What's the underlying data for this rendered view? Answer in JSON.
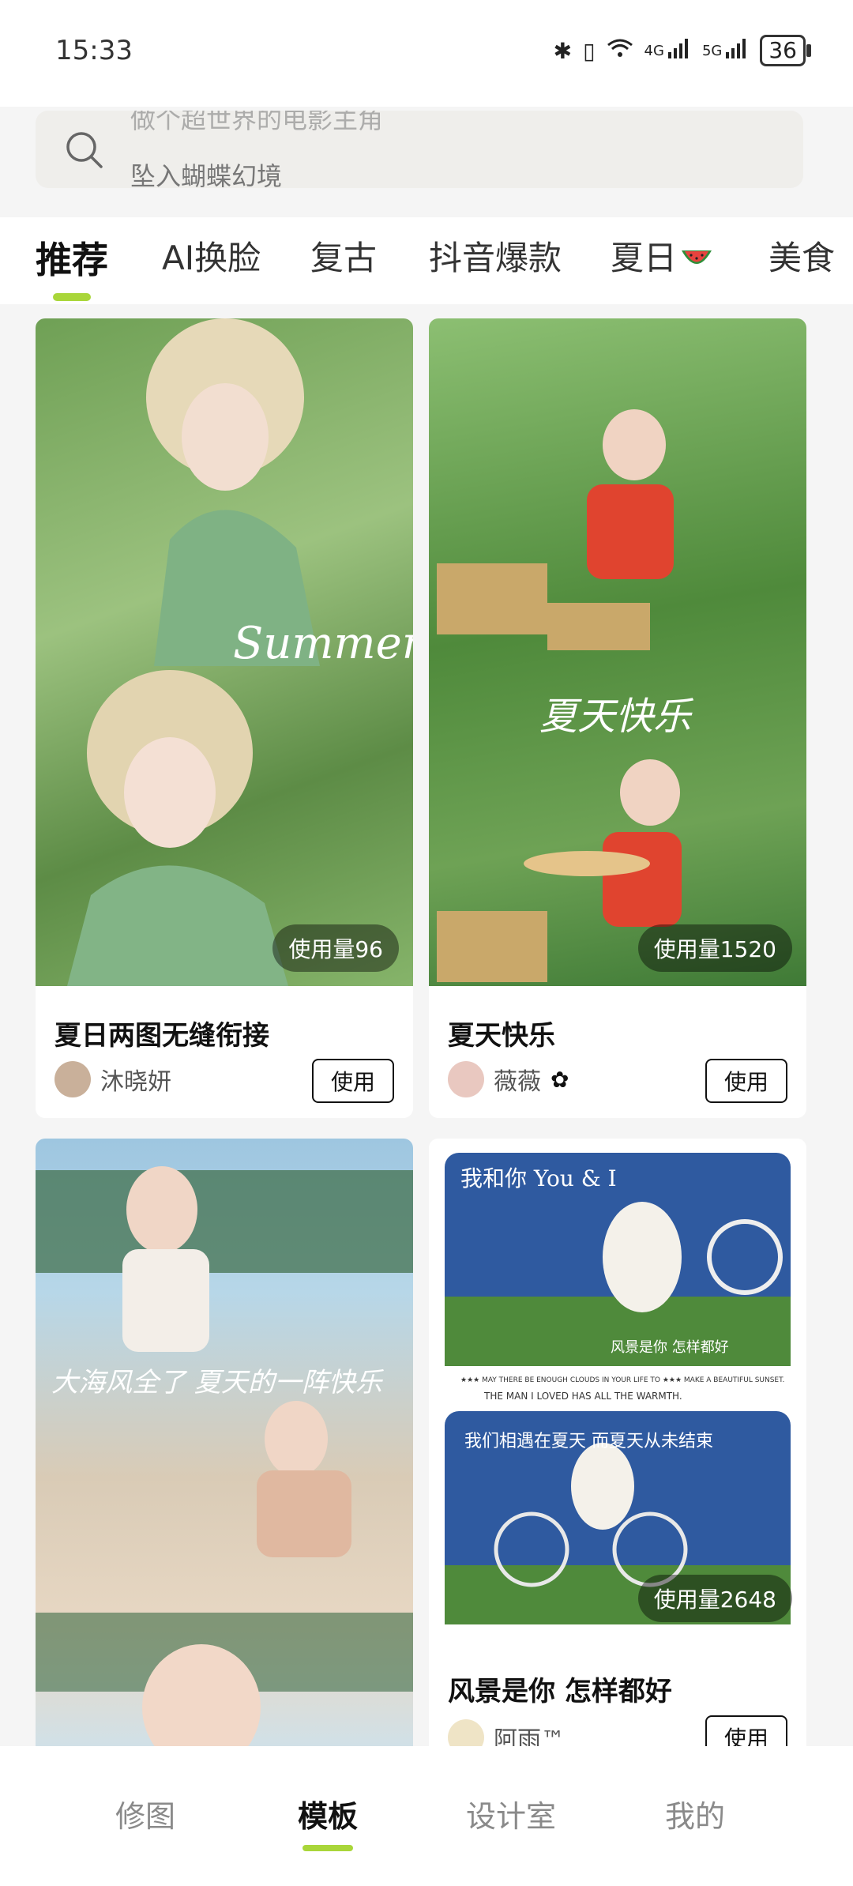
{
  "status_bar": {
    "time": "15:33",
    "battery": "36",
    "network_4g": "4G",
    "network_5g": "5G"
  },
  "search": {
    "placeholder_prev": "做个超世界的电影主角",
    "placeholder": "坠入蝴蝶幻境"
  },
  "tabs": [
    {
      "label": "推荐",
      "active": true
    },
    {
      "label": "AI换脸"
    },
    {
      "label": "复古"
    },
    {
      "label": "抖音爆款"
    },
    {
      "label": "夏日"
    },
    {
      "label": "美食"
    }
  ],
  "templates": [
    {
      "title": "夏日两图无缝衔接",
      "usage": "使用量96",
      "author": "沐晓妍",
      "use_label": "使用",
      "overlay_text": "Summer"
    },
    {
      "title": "夏天快乐",
      "usage": "使用量1520",
      "author": "薇薇",
      "use_label": "使用",
      "overlay_text": "夏天快乐"
    },
    {
      "title": "",
      "overlay_text": "大海风全了 夏天的一阵快乐"
    },
    {
      "title": "风景是你 怎样都好",
      "usage": "使用量2648",
      "author": "阿雨™",
      "use_label": "使用",
      "overlay_top": "我和你 You & I",
      "overlay_caption1": "★★★ MAY THERE BE ENOUGH CLOUDS IN YOUR LIFE TO ★★★ MAKE A BEAUTIFUL SUNSET.",
      "overlay_caption2": "THE MAN I LOVED HAS ALL THE WARMTH.",
      "overlay_mid": "风景是你 怎样都好",
      "overlay_bottom": "我们相遇在夏天 而夏天从未结束"
    }
  ],
  "bottom_nav": [
    {
      "label": "修图"
    },
    {
      "label": "模板",
      "active": true
    },
    {
      "label": "设计室"
    },
    {
      "label": "我的"
    }
  ],
  "colors": {
    "accent": "#a9d63a",
    "background": "#f5f5f5",
    "search_bg": "#efeeeb"
  }
}
